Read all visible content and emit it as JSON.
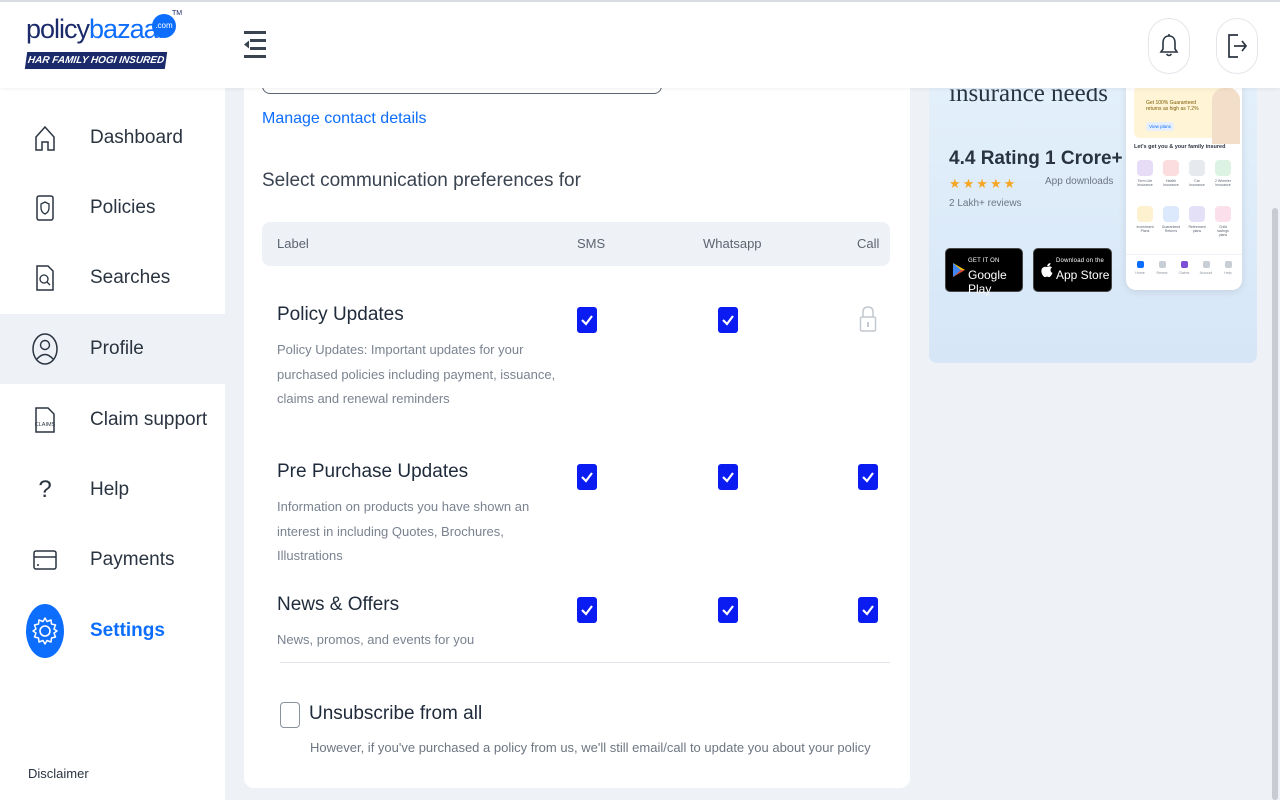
{
  "brand": {
    "name_part1": "policy",
    "name_part2": "bazaar",
    "com": ".com",
    "tm": "TM",
    "tagline": "HAR FAMILY HOGI INSURED"
  },
  "sidebar": {
    "items": [
      {
        "label": "Dashboard",
        "icon": "home-icon"
      },
      {
        "label": "Policies",
        "icon": "policy-document-icon"
      },
      {
        "label": "Searches",
        "icon": "search-document-icon"
      },
      {
        "label": "Profile",
        "icon": "user-icon"
      },
      {
        "label": "Claim support",
        "icon": "claims-icon",
        "icon_text": "CLAIMS"
      },
      {
        "label": "Help",
        "icon": "question-mark-icon",
        "icon_text": "?"
      },
      {
        "label": "Payments",
        "icon": "card-icon"
      },
      {
        "label": "Settings",
        "icon": "gear-icon"
      }
    ],
    "active": "Settings",
    "disclaimer": "Disclaimer"
  },
  "main": {
    "manage_link": "Manage contact details",
    "prefs_title": "Select communication preferences for",
    "columns": [
      "Label",
      "SMS",
      "Whatsapp",
      "Call"
    ],
    "rows": [
      {
        "title": "Policy Updates",
        "description": "Policy Updates: Important updates for your purchased policies including payment, issuance, claims and renewal reminders",
        "sms": true,
        "whatsapp": true,
        "call": "locked"
      },
      {
        "title": "Pre Purchase Updates",
        "description": "Information on products you have shown an interest in including Quotes, Brochures, Illustrations",
        "sms": true,
        "whatsapp": true,
        "call": true
      },
      {
        "title": "News & Offers",
        "description": "News, promos, and events for you",
        "sms": true,
        "whatsapp": true,
        "call": true
      }
    ],
    "unsubscribe": {
      "label": "Unsubscribe from all",
      "checked": false,
      "note": "However, if you've purchased a policy from us, we'll still email/call to update you about your policy"
    },
    "checkbox_color": "#0a1cf2"
  },
  "promo": {
    "heading": "insurance needs",
    "rating_value": "4.4 Rating",
    "stars": "★★★★★",
    "reviews": "2 Lakh+ reviews",
    "downloads_value": "1 Crore+",
    "downloads_label": "App downloads",
    "google_play_small": "GET IT ON",
    "google_play_big": "Google Play",
    "app_store_small": "Download on the",
    "app_store_big": "App Store",
    "phone": {
      "banner_text": "Get 100% Guaranteed returns as high as 7.2%",
      "banner_button": "View plans",
      "caption": "Let's get you & your family insured",
      "tiles": [
        "Term Life Insurance",
        "Health Insurance",
        "Car Insurance",
        "2 Wheeler Insurance",
        "Investment Plans",
        "Guaranteed Returns",
        "Retirement plans",
        "Child savings plans"
      ],
      "nav": [
        "Home",
        "Renew",
        "Claims",
        "Account",
        "Help"
      ]
    }
  },
  "colors": {
    "accent": "#0d6efd",
    "brand_dark": "#1b2a6b",
    "star": "#f5a623"
  }
}
